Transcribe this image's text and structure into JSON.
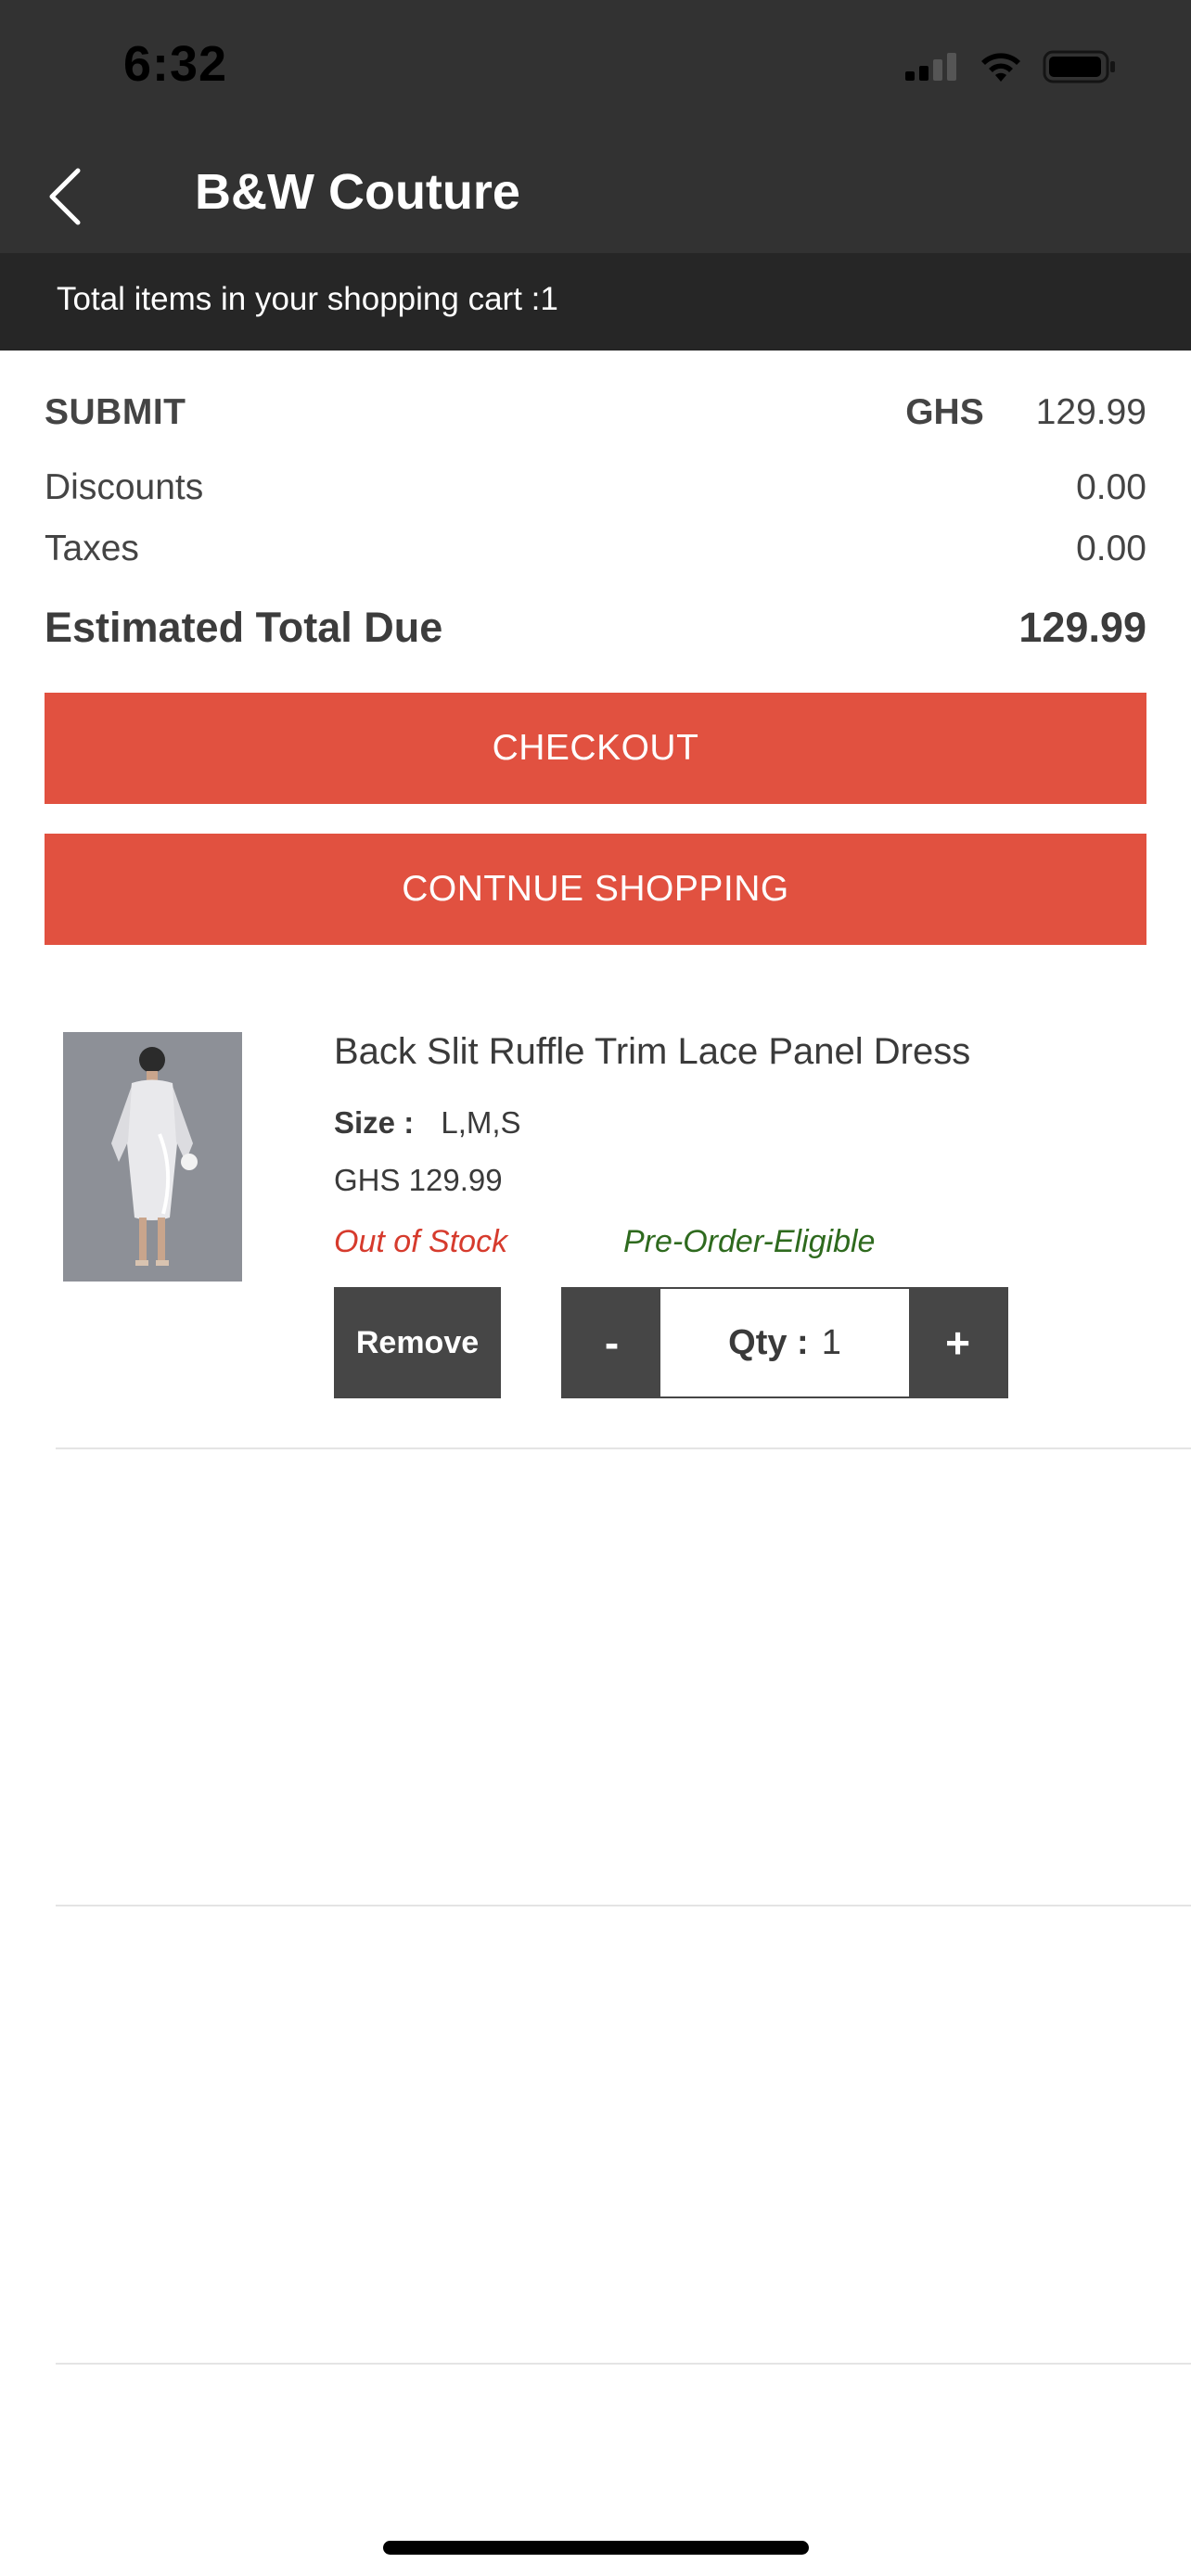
{
  "status_bar": {
    "time": "6:32",
    "icons": [
      "signal-icon",
      "wifi-icon",
      "battery-icon"
    ]
  },
  "nav": {
    "back_icon": "chevron-left-icon",
    "title": "B&W Couture"
  },
  "cart_banner": {
    "text": "Total items in your shopping cart :1"
  },
  "summary": {
    "submit_label": "SUBMIT",
    "currency": "GHS",
    "subtotal": "129.99",
    "discounts_label": "Discounts",
    "discounts_value": "0.00",
    "taxes_label": "Taxes",
    "taxes_value": "0.00",
    "total_label": "Estimated Total Due",
    "total_value": "129.99"
  },
  "buttons": {
    "checkout": "CHECKOUT",
    "continue": "CONTNUE SHOPPING"
  },
  "cart_items": [
    {
      "name": "Back Slit Ruffle Trim Lace Panel Dress",
      "size_label": "Size :",
      "size_value": "L,M,S",
      "price": "GHS 129.99",
      "stock_status": "Out of Stock",
      "preorder_status": "Pre-Order-Eligible",
      "remove_label": "Remove",
      "qty_minus": "-",
      "qty_label": "Qty :",
      "qty_value": "1",
      "qty_plus": "+"
    }
  ],
  "colors": {
    "header_bg": "#323232",
    "banner_bg": "#262626",
    "accent": "#e15140",
    "dark_button": "#464646",
    "out_of_stock": "#d63b2d",
    "preorder": "#2e6a1e"
  }
}
